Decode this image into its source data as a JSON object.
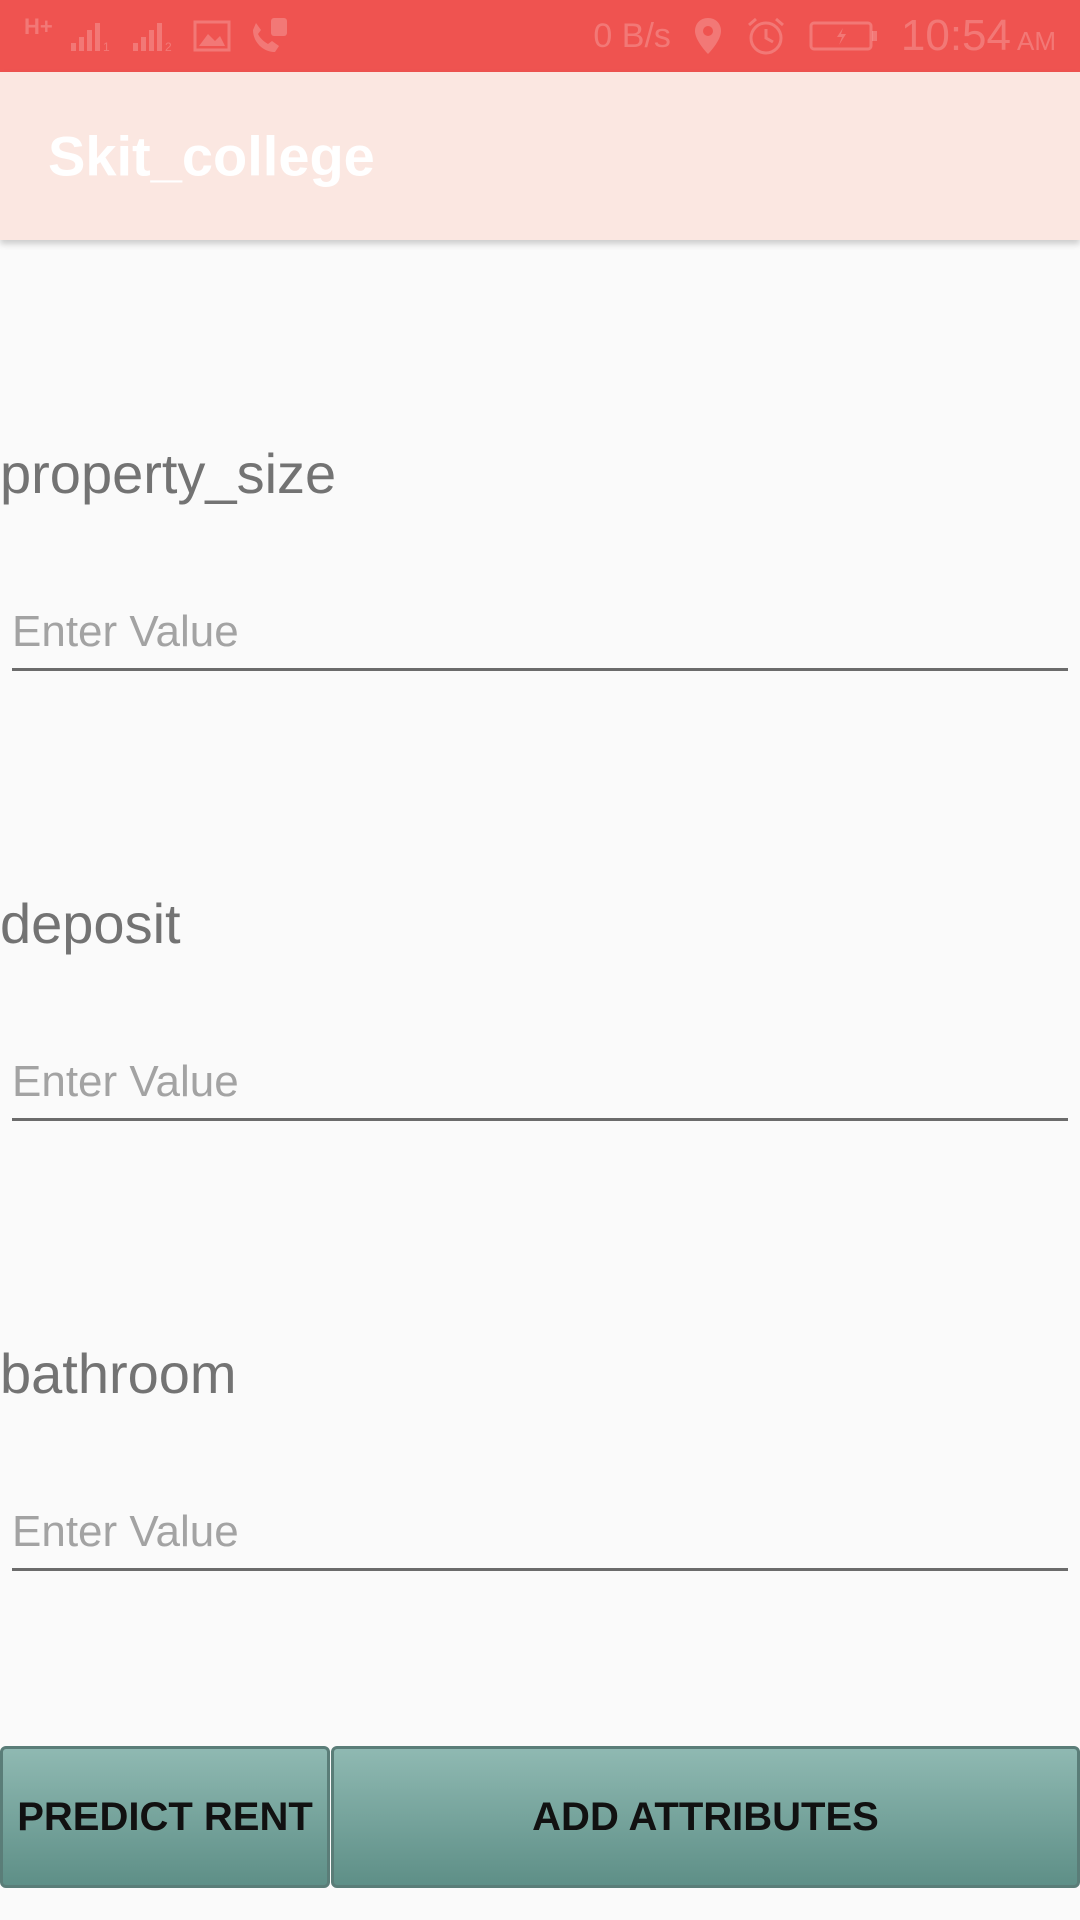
{
  "status_bar": {
    "network_type": "H+",
    "signal_1_label": "1",
    "signal_2_label": "2",
    "net_speed": "0 B/s",
    "time": "10:54",
    "ampm": "AM",
    "icons": [
      "signal-icon",
      "signal-icon",
      "gallery-icon",
      "missed-call-icon",
      "location-icon",
      "alarm-icon",
      "battery-icon"
    ],
    "color": "#ef5350"
  },
  "app_bar": {
    "title": "Skit_college",
    "color": "#fbe7e1"
  },
  "form": {
    "fields": [
      {
        "label": "property_size",
        "placeholder": "Enter Value"
      },
      {
        "label": "deposit",
        "placeholder": "Enter Value"
      },
      {
        "label": "bathroom",
        "placeholder": "Enter Value"
      }
    ]
  },
  "buttons": {
    "predict_label": "PREDICT RENT",
    "add_label": "ADD ATTRIBUTES",
    "color": "#7ba69f"
  }
}
